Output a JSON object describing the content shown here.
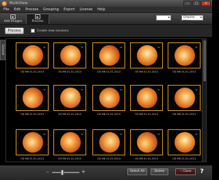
{
  "window": {
    "title": "MultiView"
  },
  "menu": [
    "File",
    "Edit",
    "Process",
    "Grouping",
    "Export",
    "License",
    "Help"
  ],
  "toolbar": {
    "add_images": "Add Images",
    "process": "Process",
    "combo_left": "",
    "combo_right": "Display View"
  },
  "subbar": {
    "process_button": "Process",
    "checkbox_label": "Create new sessions"
  },
  "sidetab": {
    "label": "Dataset"
  },
  "thumbnails": [
    {
      "caption": "OD M6 01-01-2013"
    },
    {
      "caption": "OS M6 01-01-2013"
    },
    {
      "caption": "OD M6 01-01-2013"
    },
    {
      "caption": "OS M6 01-01-2013"
    },
    {
      "caption": "OD M6 01-01-2013"
    },
    {
      "caption": "OD M6 01-01-2013"
    },
    {
      "caption": "OS M6 01-01-2013"
    },
    {
      "caption": "OD M6 01-01-2013"
    },
    {
      "caption": "OS M6 01-01-2013"
    },
    {
      "caption": "OD M6 01-01-2013"
    },
    {
      "caption": "OD M6 01-01-2013"
    },
    {
      "caption": "OS M6 01-01-2013"
    },
    {
      "caption": "OD M6 01-01-2013"
    },
    {
      "caption": "OS M6 01-01-2013"
    },
    {
      "caption": "OD M6 01-01-2013"
    }
  ],
  "bottom": {
    "select_all": "Select All",
    "delete": "Delete",
    "close": "Close",
    "help": "?",
    "zoom_level": 0.35
  },
  "colors": {
    "thumb_border": "#e0a020",
    "flag": "#4aa3e0"
  }
}
